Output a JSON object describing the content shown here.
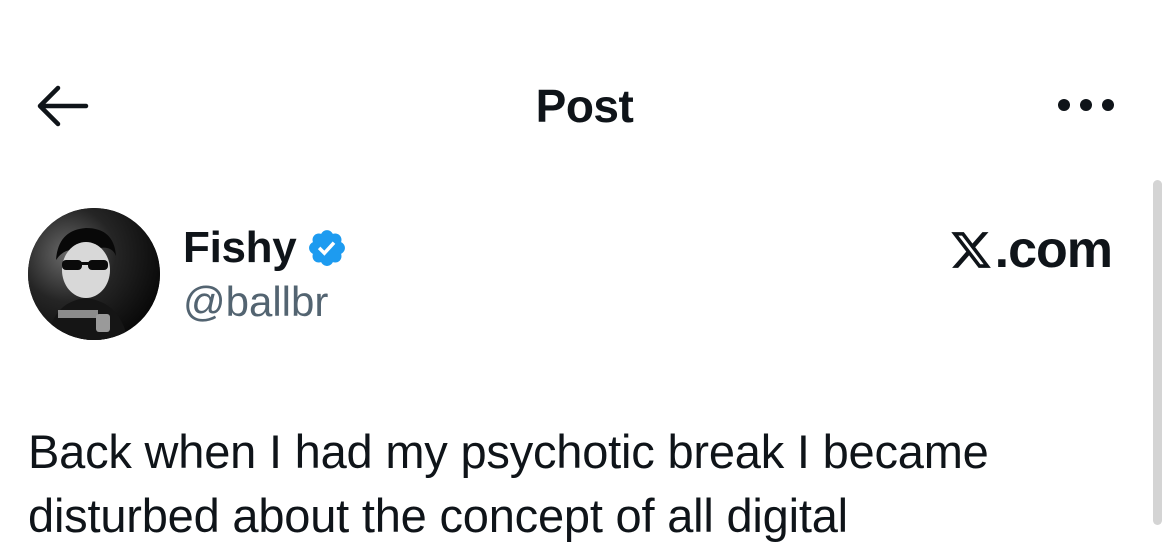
{
  "header": {
    "title": "Post",
    "back_icon": "arrow-left-icon",
    "more_icon": "more-horizontal-icon"
  },
  "author": {
    "name": "Fishy",
    "handle": "@ballbr",
    "verified": true,
    "verified_color": "#1d9bf0"
  },
  "watermark": {
    "text": ".com",
    "logo": "x-logo-icon"
  },
  "post": {
    "text": "Back when I had my psychotic break I became disturbed about the concept of all digital"
  },
  "colors": {
    "text": "#0f1419",
    "secondary": "#536471",
    "accent": "#1d9bf0",
    "background": "#ffffff"
  }
}
